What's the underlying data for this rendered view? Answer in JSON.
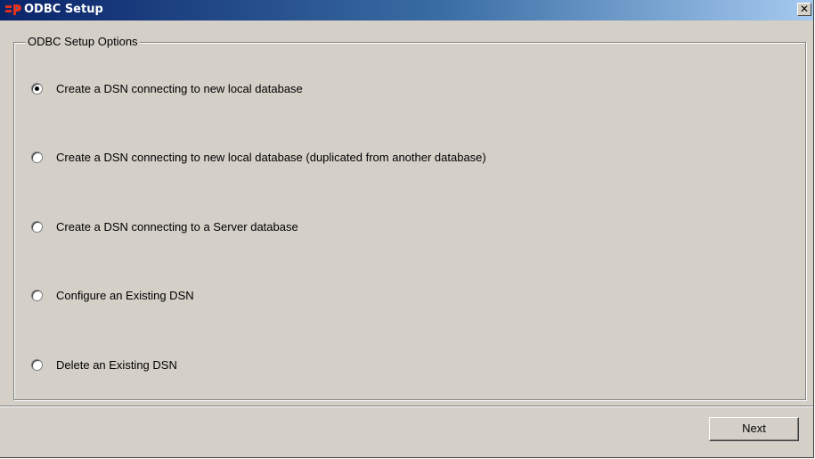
{
  "window": {
    "title": "ODBC Setup",
    "close_glyph": "✕",
    "icon": "app-logo-icon"
  },
  "group": {
    "legend": "ODBC Setup Options",
    "options": [
      {
        "label": "Create a DSN connecting to new local database",
        "selected": true
      },
      {
        "label": "Create a DSN connecting to new local database (duplicated from another database)",
        "selected": false
      },
      {
        "label": "Create a DSN connecting to a Server database",
        "selected": false
      },
      {
        "label": "Configure an Existing DSN",
        "selected": false
      },
      {
        "label": "Delete an Existing DSN",
        "selected": false
      }
    ]
  },
  "footer": {
    "next_label": "Next"
  },
  "colors": {
    "titlebar_start": "#0a246a",
    "titlebar_end": "#a6caf0",
    "face": "#d4d0c8",
    "logo_red": "#e03020"
  }
}
